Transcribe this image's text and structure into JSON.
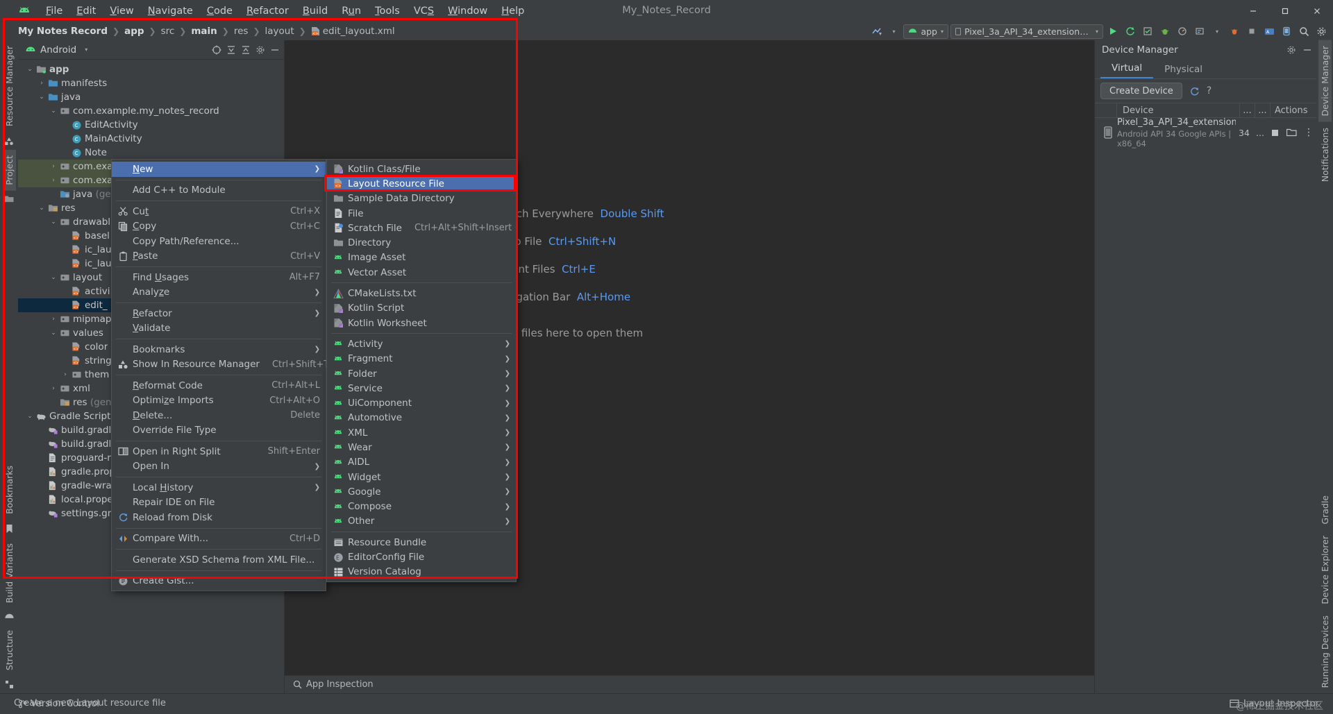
{
  "window": {
    "title": "My_Notes_Record",
    "controls": [
      "minimize",
      "maximize",
      "close"
    ]
  },
  "menubar": {
    "items": [
      {
        "label": "File",
        "mnemonic": "F"
      },
      {
        "label": "Edit",
        "mnemonic": "E"
      },
      {
        "label": "View",
        "mnemonic": "V"
      },
      {
        "label": "Navigate",
        "mnemonic": "N"
      },
      {
        "label": "Code",
        "mnemonic": "C"
      },
      {
        "label": "Refactor",
        "mnemonic": "R"
      },
      {
        "label": "Build",
        "mnemonic": "B"
      },
      {
        "label": "Run",
        "mnemonic": "u"
      },
      {
        "label": "Tools",
        "mnemonic": "T"
      },
      {
        "label": "VCS",
        "mnemonic": "S"
      },
      {
        "label": "Window",
        "mnemonic": "W"
      },
      {
        "label": "Help",
        "mnemonic": "H"
      }
    ]
  },
  "breadcrumb": {
    "items": [
      "My Notes Record",
      "app",
      "src",
      "main",
      "res",
      "layout",
      "edit_layout.xml"
    ],
    "bold": [
      true,
      true,
      false,
      true,
      false,
      false,
      false
    ]
  },
  "toolbar": {
    "run_config": "app",
    "device": "Pixel_3a_API_34_extension_level_7...",
    "icons": [
      "make-project-icon",
      "run-icon",
      "run-with-coverage-icon",
      "profile-icon",
      "debug-icon",
      "logcat-icon",
      "device-icon",
      "stop-icon",
      "search-icon",
      "settings-icon"
    ]
  },
  "left_strip": {
    "tabs": [
      "Resource Manager",
      "Project",
      "Bookmarks",
      "Build Variants",
      "Structure"
    ]
  },
  "right_strip": {
    "tabs": [
      "Device Manager",
      "Notifications",
      "Gradle",
      "Device Explorer",
      "Running Devices"
    ]
  },
  "project_panel": {
    "title": "Android",
    "header_icons": [
      "select-opened-file-icon",
      "expand-all-icon",
      "collapse-all-icon",
      "settings-icon",
      "hide-icon"
    ],
    "tree": [
      {
        "depth": 0,
        "arrow": "down",
        "icon": "module-folder",
        "label": "app",
        "bold": true
      },
      {
        "depth": 1,
        "arrow": "right",
        "icon": "folder",
        "label": "manifests"
      },
      {
        "depth": 1,
        "arrow": "down",
        "icon": "folder",
        "label": "java"
      },
      {
        "depth": 2,
        "arrow": "down",
        "icon": "package",
        "label": "com.example.my_notes_record"
      },
      {
        "depth": 3,
        "arrow": "none",
        "icon": "class",
        "label": "EditActivity"
      },
      {
        "depth": 3,
        "arrow": "none",
        "icon": "class",
        "label": "MainActivity"
      },
      {
        "depth": 3,
        "arrow": "none",
        "icon": "class",
        "label": "Note"
      },
      {
        "depth": 2,
        "arrow": "right",
        "icon": "package",
        "label": "com.exa",
        "selected": "green"
      },
      {
        "depth": 2,
        "arrow": "right",
        "icon": "package",
        "label": "com.exa",
        "selected": "green"
      },
      {
        "depth": 2,
        "arrow": "none",
        "icon": "folder-gen",
        "label": "java ",
        "dim": "(genera"
      },
      {
        "depth": 1,
        "arrow": "down",
        "icon": "res-folder",
        "label": "res"
      },
      {
        "depth": 2,
        "arrow": "down",
        "icon": "package",
        "label": "drawabl"
      },
      {
        "depth": 3,
        "arrow": "none",
        "icon": "xml-file",
        "label": "basel"
      },
      {
        "depth": 3,
        "arrow": "none",
        "icon": "xml-file",
        "label": "ic_lau"
      },
      {
        "depth": 3,
        "arrow": "none",
        "icon": "xml-file",
        "label": "ic_lau"
      },
      {
        "depth": 2,
        "arrow": "down",
        "icon": "package",
        "label": "layout"
      },
      {
        "depth": 3,
        "arrow": "none",
        "icon": "xml-file",
        "label": "activi"
      },
      {
        "depth": 3,
        "arrow": "none",
        "icon": "xml-file",
        "label": "edit_",
        "selected": "blue"
      },
      {
        "depth": 2,
        "arrow": "right",
        "icon": "package",
        "label": "mipmap"
      },
      {
        "depth": 2,
        "arrow": "down",
        "icon": "package",
        "label": "values"
      },
      {
        "depth": 3,
        "arrow": "none",
        "icon": "xml-file",
        "label": "color"
      },
      {
        "depth": 3,
        "arrow": "none",
        "icon": "xml-file",
        "label": "string"
      },
      {
        "depth": 3,
        "arrow": "right",
        "icon": "package",
        "label": "them"
      },
      {
        "depth": 2,
        "arrow": "right",
        "icon": "package",
        "label": "xml"
      },
      {
        "depth": 2,
        "arrow": "none",
        "icon": "res-folder",
        "label": "res ",
        "dim": "(genera"
      },
      {
        "depth": 0,
        "arrow": "down",
        "icon": "gradle",
        "label": "Gradle Scripts"
      },
      {
        "depth": 1,
        "arrow": "none",
        "icon": "gradle-file",
        "label": "build.gradl"
      },
      {
        "depth": 1,
        "arrow": "none",
        "icon": "gradle-file",
        "label": "build.gradl"
      },
      {
        "depth": 1,
        "arrow": "none",
        "icon": "text-file",
        "label": "proguard-r"
      },
      {
        "depth": 1,
        "arrow": "none",
        "icon": "props-file",
        "label": "gradle.prop"
      },
      {
        "depth": 1,
        "arrow": "none",
        "icon": "props-file",
        "label": "gradle-wrap"
      },
      {
        "depth": 1,
        "arrow": "none",
        "icon": "props-file",
        "label": "local.prope"
      },
      {
        "depth": 1,
        "arrow": "none",
        "icon": "gradle-file",
        "label": "settings.gra"
      }
    ]
  },
  "context_menu": {
    "items": [
      {
        "label": "New",
        "mnemonic": "N",
        "submenu": true,
        "highlight": true
      },
      {
        "sep": true
      },
      {
        "label": "Add C++ to Module"
      },
      {
        "sep": true
      },
      {
        "label": "Cut",
        "mnemonic": "t",
        "shortcut": "Ctrl+X",
        "icon": "scissors-icon"
      },
      {
        "label": "Copy",
        "mnemonic": "C",
        "shortcut": "Ctrl+C",
        "icon": "copy-icon"
      },
      {
        "label": "Copy Path/Reference..."
      },
      {
        "label": "Paste",
        "mnemonic": "P",
        "shortcut": "Ctrl+V",
        "icon": "paste-icon"
      },
      {
        "sep": true
      },
      {
        "label": "Find Usages",
        "mnemonic": "U",
        "shortcut": "Alt+F7"
      },
      {
        "label": "Analyze",
        "mnemonic": "z",
        "submenu": true
      },
      {
        "sep": true
      },
      {
        "label": "Refactor",
        "mnemonic": "R",
        "submenu": true
      },
      {
        "label": "Validate",
        "mnemonic": "V"
      },
      {
        "sep": true
      },
      {
        "label": "Bookmarks",
        "submenu": true
      },
      {
        "label": "Show In Resource Manager",
        "shortcut": "Ctrl+Shift+T",
        "icon": "resource-manager-icon"
      },
      {
        "sep": true
      },
      {
        "label": "Reformat Code",
        "mnemonic": "R",
        "shortcut": "Ctrl+Alt+L"
      },
      {
        "label": "Optimize Imports",
        "mnemonic": "z",
        "shortcut": "Ctrl+Alt+O"
      },
      {
        "label": "Delete...",
        "mnemonic": "D",
        "shortcut": "Delete"
      },
      {
        "label": "Override File Type"
      },
      {
        "sep": true
      },
      {
        "label": "Open in Right Split",
        "shortcut": "Shift+Enter",
        "icon": "split-icon"
      },
      {
        "label": "Open In",
        "submenu": true
      },
      {
        "sep": true
      },
      {
        "label": "Local History",
        "mnemonic": "H",
        "submenu": true
      },
      {
        "label": "Repair IDE on File"
      },
      {
        "label": "Reload from Disk",
        "icon": "reload-icon"
      },
      {
        "sep": true
      },
      {
        "label": "Compare With...",
        "shortcut": "Ctrl+D",
        "icon": "compare-icon"
      },
      {
        "sep": true
      },
      {
        "label": "Generate XSD Schema from XML File..."
      },
      {
        "sep": true
      },
      {
        "label": "Create Gist...",
        "icon": "gist-icon"
      }
    ]
  },
  "submenu": {
    "items": [
      {
        "label": "Kotlin Class/File",
        "icon": "kotlin-file-icon"
      },
      {
        "label": "Layout Resource File",
        "icon": "xml-file-icon",
        "highlight": true
      },
      {
        "label": "Sample Data Directory",
        "icon": "folder-icon"
      },
      {
        "label": "File",
        "icon": "file-icon"
      },
      {
        "label": "Scratch File",
        "shortcut": "Ctrl+Alt+Shift+Insert",
        "icon": "scratch-file-icon"
      },
      {
        "label": "Directory",
        "icon": "folder-icon"
      },
      {
        "label": "Image Asset",
        "icon": "android-icon"
      },
      {
        "label": "Vector Asset",
        "icon": "android-icon"
      },
      {
        "sep": true
      },
      {
        "label": "CMakeLists.txt",
        "icon": "cmake-icon"
      },
      {
        "label": "Kotlin Script",
        "icon": "kotlin-file-icon"
      },
      {
        "label": "Kotlin Worksheet",
        "icon": "kotlin-file-icon"
      },
      {
        "sep": true
      },
      {
        "label": "Activity",
        "icon": "android-icon",
        "submenu": true
      },
      {
        "label": "Fragment",
        "icon": "android-icon",
        "submenu": true
      },
      {
        "label": "Folder",
        "icon": "android-icon",
        "submenu": true
      },
      {
        "label": "Service",
        "icon": "android-icon",
        "submenu": true
      },
      {
        "label": "UiComponent",
        "icon": "android-icon",
        "submenu": true
      },
      {
        "label": "Automotive",
        "icon": "android-icon",
        "submenu": true
      },
      {
        "label": "XML",
        "icon": "android-icon",
        "submenu": true
      },
      {
        "label": "Wear",
        "icon": "android-icon",
        "submenu": true
      },
      {
        "label": "AIDL",
        "icon": "android-icon",
        "submenu": true
      },
      {
        "label": "Widget",
        "icon": "android-icon",
        "submenu": true
      },
      {
        "label": "Google",
        "icon": "android-icon",
        "submenu": true
      },
      {
        "label": "Compose",
        "icon": "android-icon",
        "submenu": true
      },
      {
        "label": "Other",
        "icon": "android-icon",
        "submenu": true
      },
      {
        "sep": true
      },
      {
        "label": "Resource Bundle",
        "icon": "bundle-icon"
      },
      {
        "label": "EditorConfig File",
        "icon": "editorconfig-icon"
      },
      {
        "label": "Version Catalog",
        "icon": "catalog-icon"
      }
    ]
  },
  "editor": {
    "tips": [
      {
        "text": "Search Everywhere",
        "key": "Double Shift"
      },
      {
        "text": "Go to File",
        "key": "Ctrl+Shift+N"
      },
      {
        "text": "Recent Files",
        "key": "Ctrl+E"
      },
      {
        "text": "Navigation Bar",
        "key": "Alt+Home"
      },
      {
        "text": "Drop files here to open them",
        "key": ""
      }
    ]
  },
  "device_manager": {
    "title": "Device Manager",
    "header_icons": [
      "settings-icon",
      "hide-icon"
    ],
    "tabs": [
      {
        "label": "Virtual",
        "active": true
      },
      {
        "label": "Physical",
        "active": false
      }
    ],
    "create_button": "Create Device",
    "action_icons": [
      "refresh-icon",
      "help-icon"
    ],
    "columns": [
      "",
      "Device",
      "...",
      "...",
      "Actions"
    ],
    "rows": [
      {
        "name": "Pixel_3a_API_34_extension_...",
        "subtitle": "Android API 34 Google APIs | x86_64",
        "api": "34",
        "more": "...",
        "online": true,
        "actions": [
          "stop-icon",
          "folder-icon",
          "more-icon"
        ]
      }
    ]
  },
  "bottom_tools": {
    "items": [
      {
        "label": "App Inspection",
        "icon": "app-inspection-icon"
      }
    ]
  },
  "status_bar": {
    "left": [
      {
        "label": "Version Control",
        "icon": "branch-icon"
      },
      {
        "label": "Create a new Layout resource file",
        "icon": ""
      }
    ],
    "version_control": "Version Control",
    "message": "Create a new Layout resource file",
    "right": [
      {
        "label": "Layout Inspector",
        "icon": "layout-inspector-icon"
      }
    ]
  },
  "watermark": "@稀土掘金技术社区",
  "colors": {
    "accent_blue": "#4b6eaf",
    "annotation_red": "#fe0000",
    "background": "#3c3f41",
    "editor_bg": "#2b2b2b",
    "selection_blue": "#0d293e",
    "selection_green": "#4a5340",
    "android_green": "#4ddb7f",
    "link_blue": "#5a9bf0"
  }
}
